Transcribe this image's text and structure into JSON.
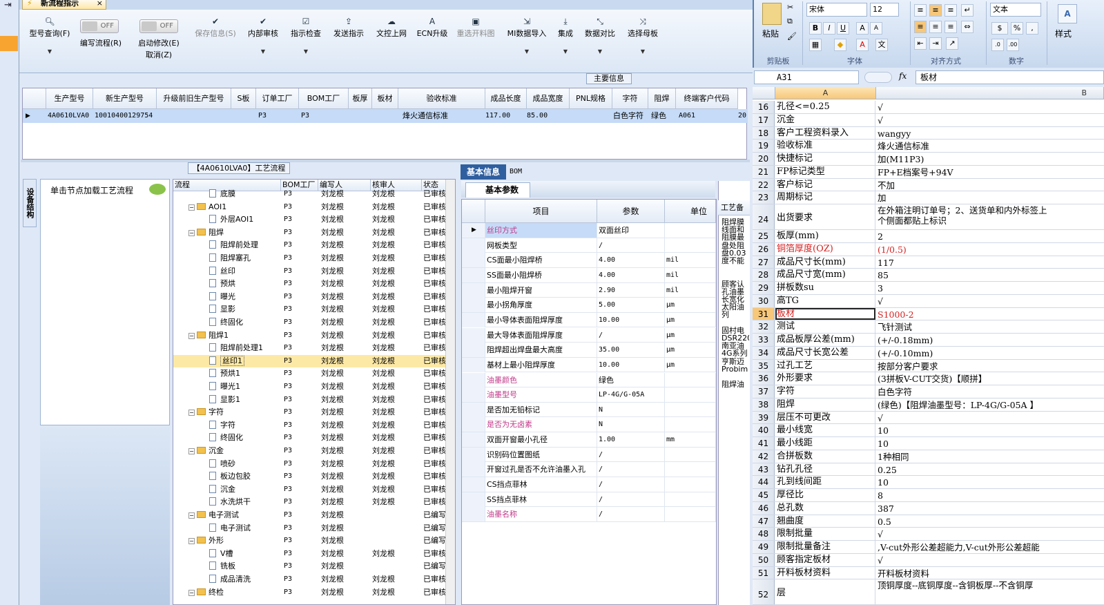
{
  "app": {
    "tab_title": "新流程指示",
    "tab_close": "×"
  },
  "toolbar": {
    "items": [
      {
        "label": "型号查询(F)",
        "icon": "search-icon"
      },
      {
        "label": "编写流程(R)",
        "toggle": "OFF"
      },
      {
        "label": "启动修改(E)",
        "sub": "取消(Z)",
        "toggle": "OFF"
      },
      {
        "label": "保存信息(S)",
        "icon": "check-icon",
        "disabled": true
      },
      {
        "label": "内部审核",
        "icon": "check-icon"
      },
      {
        "label": "指示检查",
        "icon": "check-box-icon"
      },
      {
        "label": "发送指示",
        "icon": "upload-icon"
      },
      {
        "label": "文控上网",
        "icon": "cloud-icon"
      },
      {
        "label": "ECN升级",
        "icon": "ecn-icon"
      },
      {
        "label": "重选开料图",
        "icon": "image-icon",
        "disabled": true
      },
      {
        "label": "MI数据导入",
        "icon": "import-icon"
      },
      {
        "label": "集成",
        "icon": "download-icon"
      },
      {
        "label": "数据对比",
        "icon": "compare-icon"
      },
      {
        "label": "选择母板",
        "icon": "shuffle-icon"
      }
    ]
  },
  "main_info": {
    "label": "主要信息",
    "columns": [
      "生产型号",
      "新生产型号",
      "升级前旧生产型号",
      "S板",
      "订单工厂",
      "BOM工厂",
      "板厚",
      "板材",
      "验收标准",
      "成品长度",
      "成品宽度",
      "PNL规格",
      "字符",
      "阻焊",
      "终端客户代码"
    ],
    "row": [
      "4A0610LVA0",
      "10010400129754",
      "",
      "",
      "P3",
      "P3",
      "",
      "",
      "烽火通信标准",
      "117.00",
      "85.00",
      "",
      "白色字符",
      "绿色",
      "A061",
      "20"
    ]
  },
  "process": {
    "title": "【4A0610LVA0】工艺流程",
    "side_tab": "设备结构",
    "hint": "单击节点加载工艺流程",
    "columns": [
      "流程",
      "BOM工厂",
      "编写人",
      "核审人",
      "状态"
    ],
    "rows": [
      {
        "level": 1,
        "type": "doc",
        "name": "底膜",
        "bom": "P3",
        "writer": "刘龙根",
        "reviewer": "刘龙根",
        "status": "已审核"
      },
      {
        "level": 0,
        "type": "folder",
        "name": "AOI1",
        "bom": "P3",
        "writer": "刘龙根",
        "reviewer": "刘龙根",
        "status": "已审核"
      },
      {
        "level": 1,
        "type": "doc",
        "name": "外层AOI1",
        "bom": "P3",
        "writer": "刘龙根",
        "reviewer": "刘龙根",
        "status": "已审核"
      },
      {
        "level": 0,
        "type": "folder",
        "name": "阻焊",
        "bom": "P3",
        "writer": "刘龙根",
        "reviewer": "刘龙根",
        "status": "已审核"
      },
      {
        "level": 1,
        "type": "doc",
        "name": "阻焊前处理",
        "bom": "P3",
        "writer": "刘龙根",
        "reviewer": "刘龙根",
        "status": "已审核"
      },
      {
        "level": 1,
        "type": "doc",
        "name": "阻焊塞孔",
        "bom": "P3",
        "writer": "刘龙根",
        "reviewer": "刘龙根",
        "status": "已审核"
      },
      {
        "level": 1,
        "type": "doc",
        "name": "丝印",
        "bom": "P3",
        "writer": "刘龙根",
        "reviewer": "刘龙根",
        "status": "已审核"
      },
      {
        "level": 1,
        "type": "doc",
        "name": "预烘",
        "bom": "P3",
        "writer": "刘龙根",
        "reviewer": "刘龙根",
        "status": "已审核"
      },
      {
        "level": 1,
        "type": "doc",
        "name": "曝光",
        "bom": "P3",
        "writer": "刘龙根",
        "reviewer": "刘龙根",
        "status": "已审核"
      },
      {
        "level": 1,
        "type": "doc",
        "name": "显影",
        "bom": "P3",
        "writer": "刘龙根",
        "reviewer": "刘龙根",
        "status": "已审核"
      },
      {
        "level": 1,
        "type": "doc",
        "name": "终固化",
        "bom": "P3",
        "writer": "刘龙根",
        "reviewer": "刘龙根",
        "status": "已审核"
      },
      {
        "level": 0,
        "type": "folder",
        "name": "阻焊1",
        "bom": "P3",
        "writer": "刘龙根",
        "reviewer": "刘龙根",
        "status": "已审核"
      },
      {
        "level": 1,
        "type": "doc",
        "name": "阻焊前处理1",
        "bom": "P3",
        "writer": "刘龙根",
        "reviewer": "刘龙根",
        "status": "已审核"
      },
      {
        "level": 1,
        "type": "doc",
        "name": "丝印1",
        "bom": "P3",
        "writer": "刘龙根",
        "reviewer": "刘龙根",
        "status": "已审核",
        "selected": true
      },
      {
        "level": 1,
        "type": "doc",
        "name": "预烘1",
        "bom": "P3",
        "writer": "刘龙根",
        "reviewer": "刘龙根",
        "status": "已审核"
      },
      {
        "level": 1,
        "type": "doc",
        "name": "曝光1",
        "bom": "P3",
        "writer": "刘龙根",
        "reviewer": "刘龙根",
        "status": "已审核"
      },
      {
        "level": 1,
        "type": "doc",
        "name": "显影1",
        "bom": "P3",
        "writer": "刘龙根",
        "reviewer": "刘龙根",
        "status": "已审核"
      },
      {
        "level": 0,
        "type": "folder",
        "name": "字符",
        "bom": "P3",
        "writer": "刘龙根",
        "reviewer": "刘龙根",
        "status": "已审核"
      },
      {
        "level": 1,
        "type": "doc",
        "name": "字符",
        "bom": "P3",
        "writer": "刘龙根",
        "reviewer": "刘龙根",
        "status": "已审核"
      },
      {
        "level": 1,
        "type": "doc",
        "name": "终固化",
        "bom": "P3",
        "writer": "刘龙根",
        "reviewer": "刘龙根",
        "status": "已审核"
      },
      {
        "level": 0,
        "type": "folder",
        "name": "沉金",
        "bom": "P3",
        "writer": "刘龙根",
        "reviewer": "刘龙根",
        "status": "已审核"
      },
      {
        "level": 1,
        "type": "doc",
        "name": "喷砂",
        "bom": "P3",
        "writer": "刘龙根",
        "reviewer": "刘龙根",
        "status": "已审核"
      },
      {
        "level": 1,
        "type": "doc",
        "name": "板边包胶",
        "bom": "P3",
        "writer": "刘龙根",
        "reviewer": "刘龙根",
        "status": "已审核"
      },
      {
        "level": 1,
        "type": "doc",
        "name": "沉金",
        "bom": "P3",
        "writer": "刘龙根",
        "reviewer": "刘龙根",
        "status": "已审核"
      },
      {
        "level": 1,
        "type": "doc",
        "name": "水洗烘干",
        "bom": "P3",
        "writer": "刘龙根",
        "reviewer": "刘龙根",
        "status": "已审核"
      },
      {
        "level": 0,
        "type": "folder",
        "name": "电子测试",
        "bom": "P3",
        "writer": "刘龙根",
        "reviewer": "",
        "status": "已编写"
      },
      {
        "level": 1,
        "type": "doc",
        "name": "电子测试",
        "bom": "P3",
        "writer": "刘龙根",
        "reviewer": "",
        "status": "已编写"
      },
      {
        "level": 0,
        "type": "folder",
        "name": "外形",
        "bom": "P3",
        "writer": "刘龙根",
        "reviewer": "",
        "status": "已编写"
      },
      {
        "level": 1,
        "type": "doc",
        "name": "V槽",
        "bom": "P3",
        "writer": "刘龙根",
        "reviewer": "刘龙根",
        "status": "已审核"
      },
      {
        "level": 1,
        "type": "doc",
        "name": "铣板",
        "bom": "P3",
        "writer": "刘龙根",
        "reviewer": "",
        "status": "已编写"
      },
      {
        "level": 1,
        "type": "doc",
        "name": "成品清洗",
        "bom": "P3",
        "writer": "刘龙根",
        "reviewer": "刘龙根",
        "status": "已审核"
      },
      {
        "level": 0,
        "type": "folder",
        "name": "终检",
        "bom": "P3",
        "writer": "刘龙根",
        "reviewer": "刘龙根",
        "status": "已审核"
      }
    ]
  },
  "basic_info": {
    "tabs": [
      "基本信息",
      "BOM"
    ],
    "sub_tab": "基本参数",
    "columns": [
      "项目",
      "参数",
      "单位"
    ],
    "rows": [
      {
        "item": "丝印方式",
        "value": "双面丝印",
        "unit": "",
        "pink": true,
        "current": true
      },
      {
        "item": "网板类型",
        "value": "/",
        "unit": ""
      },
      {
        "item": "CS面最小阻焊桥",
        "value": "4.00",
        "unit": "mil"
      },
      {
        "item": "SS面最小阻焊桥",
        "value": "4.00",
        "unit": "mil"
      },
      {
        "item": "最小阻焊开窗",
        "value": "2.90",
        "unit": "mil"
      },
      {
        "item": "最小拐角厚度",
        "value": "5.00",
        "unit": "μm"
      },
      {
        "item": "最小导体表面阻焊厚度",
        "value": "10.00",
        "unit": "μm"
      },
      {
        "item": "最大导体表面阻焊厚度",
        "value": "/",
        "unit": "μm"
      },
      {
        "item": "阻焊超出焊盘最大高度",
        "value": "35.00",
        "unit": "μm"
      },
      {
        "item": "基材上最小阻焊厚度",
        "value": "10.00",
        "unit": "μm"
      },
      {
        "item": "油墨颜色",
        "value": "绿色",
        "unit": "",
        "pink": true
      },
      {
        "item": "油墨型号",
        "value": "LP-4G/G-05A",
        "unit": "",
        "pink": true
      },
      {
        "item": "是否加无铅标记",
        "value": "N",
        "unit": ""
      },
      {
        "item": "是否为无卤素",
        "value": "N",
        "unit": "",
        "pink": true
      },
      {
        "item": "双面开窗最小孔径",
        "value": "1.00",
        "unit": "mm"
      },
      {
        "item": "识别码位置图纸",
        "value": "/",
        "unit": ""
      },
      {
        "item": "开窗过孔是否不允许油墨入孔",
        "value": "/",
        "unit": ""
      },
      {
        "item": "CS挡点菲林",
        "value": "/",
        "unit": ""
      },
      {
        "item": "SS挡点菲林",
        "value": "/",
        "unit": ""
      },
      {
        "item": "油墨名称",
        "value": "/",
        "unit": "",
        "pink": true
      }
    ]
  },
  "partial_panel": {
    "header": "工艺备",
    "lines": [
      "阻焊膜",
      "线面和",
      "阻膜最",
      "盘处阻",
      "盘0.03",
      "度不能",
      "",
      "",
      "顾客认",
      "孔油墨",
      "长宽化",
      "太阳油",
      "列",
      "",
      "固村电",
      "DSR220",
      "南亚油",
      "4G系列",
      "亨斯迈",
      "Probim",
      "",
      "阻焊油"
    ]
  },
  "excel": {
    "ribbon": {
      "paste_label": "粘贴",
      "clipboard_label": "剪贴板",
      "font_name": "宋体",
      "font_size": "12",
      "font_label": "字体",
      "align_label": "对齐方式",
      "number_format": "文本",
      "number_label": "数字",
      "style_label": "样式"
    },
    "name_box": "A31",
    "formula": "板材",
    "fx_label": "fx",
    "col_a": "A",
    "col_b": "B",
    "rows": [
      {
        "n": "16",
        "a": "孔径<=0.25",
        "b": "√"
      },
      {
        "n": "17",
        "a": "沉金",
        "b": "√"
      },
      {
        "n": "18",
        "a": "客户工程资料录入",
        "b": "wangyy"
      },
      {
        "n": "19",
        "a": "验收标准",
        "b": "烽火通信标准"
      },
      {
        "n": "20",
        "a": "快捷标记",
        "b": "加(M11P3)"
      },
      {
        "n": "21",
        "a": "FP标记类型",
        "b": "FP+E档案号+94V"
      },
      {
        "n": "22",
        "a": "客户标记",
        "b": "不加"
      },
      {
        "n": "23",
        "a": "周期标记",
        "b": "加"
      },
      {
        "n": "24",
        "a": "出货要求",
        "b": "在外箱注明订单号；2、送货单和内外标签上",
        "b2": "个侧面都贴上标识",
        "tall": true
      },
      {
        "n": "25",
        "a": "板厚(mm)",
        "b": "2"
      },
      {
        "n": "26",
        "a": "铜箔厚度(OZ)",
        "b": "(1/0.5)",
        "red": true
      },
      {
        "n": "27",
        "a": "成品尺寸长(mm)",
        "b": "117"
      },
      {
        "n": "28",
        "a": "成品尺寸宽(mm)",
        "b": "85"
      },
      {
        "n": "29",
        "a": "拼板数su",
        "b": "3"
      },
      {
        "n": "30",
        "a": "高TG",
        "b": "√"
      },
      {
        "n": "31",
        "a": "板材",
        "b": "S1000-2",
        "red": true,
        "sel": true
      },
      {
        "n": "32",
        "a": "测试",
        "b": "飞针测试"
      },
      {
        "n": "33",
        "a": "成品板厚公差(mm)",
        "b": "(+/-0.18mm)"
      },
      {
        "n": "34",
        "a": "成品尺寸长宽公差",
        "b": "(+/-0.10mm)"
      },
      {
        "n": "35",
        "a": "过孔工艺",
        "b": "按部分客户要求"
      },
      {
        "n": "36",
        "a": "外形要求",
        "b": "(3拼板V-CUT交货)【顺拼】"
      },
      {
        "n": "37",
        "a": "字符",
        "b": "白色字符"
      },
      {
        "n": "38",
        "a": "阻焊",
        "b": "(绿色)【阻焊油墨型号：LP-4G/G-05A 】"
      },
      {
        "n": "39",
        "a": "层压不可更改",
        "b": "√"
      },
      {
        "n": "40",
        "a": "最小线宽",
        "b": "10"
      },
      {
        "n": "41",
        "a": "最小线距",
        "b": "10"
      },
      {
        "n": "42",
        "a": "合拼板数",
        "b": "1种相同"
      },
      {
        "n": "43",
        "a": "钻孔孔径",
        "b": "0.25"
      },
      {
        "n": "44",
        "a": "孔到线间距",
        "b": "10"
      },
      {
        "n": "45",
        "a": "厚径比",
        "b": "8"
      },
      {
        "n": "46",
        "a": "总孔数",
        "b": "387"
      },
      {
        "n": "47",
        "a": "翘曲度",
        "b": "0.5"
      },
      {
        "n": "48",
        "a": "限制批量",
        "b": "√"
      },
      {
        "n": "49",
        "a": "限制批量备注",
        "b": ",V-cut外形公差超能力,V-cut外形公差超能"
      },
      {
        "n": "50",
        "a": "顾客指定板材",
        "b": "√"
      },
      {
        "n": "51",
        "a": "开料板材资料",
        "b": "开料板材资料"
      },
      {
        "n": "52",
        "a": "层",
        "b": "顶铜厚度--底铜厚度--含铜板厚--不含铜厚",
        "tall": true
      }
    ]
  }
}
